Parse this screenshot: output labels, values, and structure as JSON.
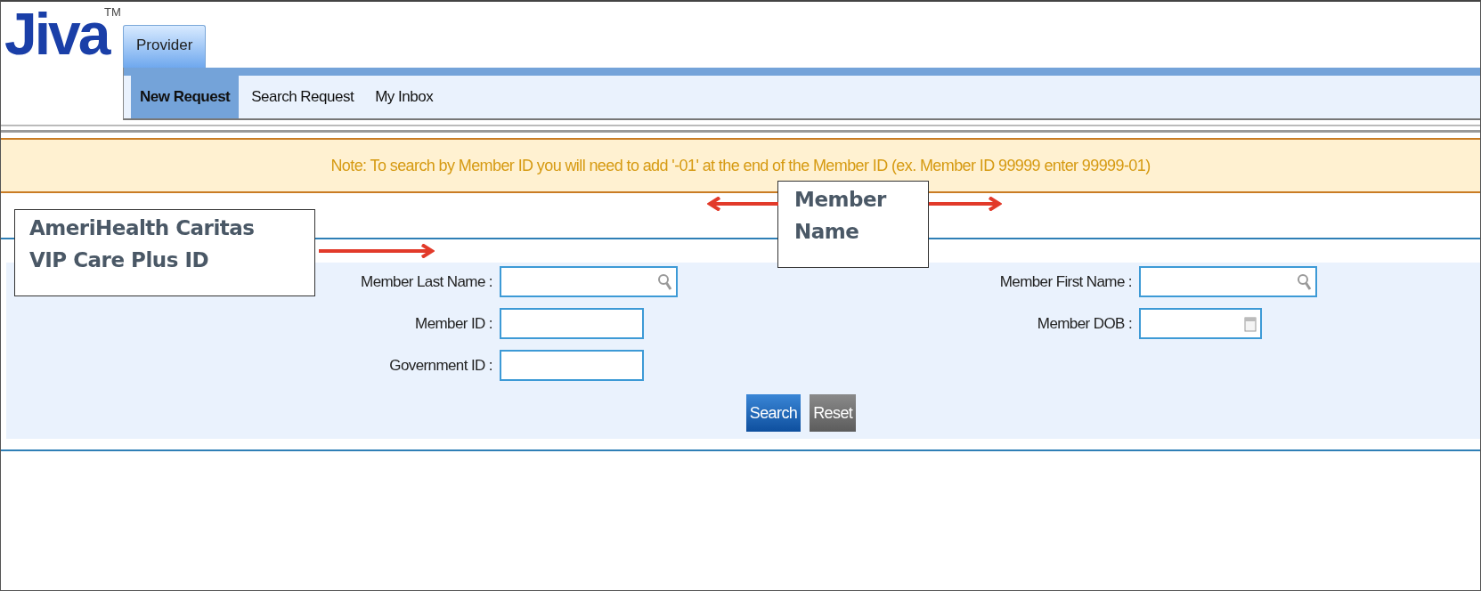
{
  "logo": {
    "text": "Jiva",
    "trademark": "TM"
  },
  "tabs": [
    {
      "label": "Provider",
      "selected": true
    }
  ],
  "subnav": [
    {
      "label": "New Request",
      "selected": true
    },
    {
      "label": "Search Request",
      "selected": false
    },
    {
      "label": "My Inbox",
      "selected": false
    }
  ],
  "note": "Note: To search by Member ID you will need to add '-01' at the end of the Member ID (ex. Member ID 99999 enter 99999-01)",
  "form": {
    "rows": [
      {
        "left": {
          "label": "Member Last Name :",
          "kind": "search"
        },
        "right": {
          "label": "Member First Name :",
          "kind": "search"
        }
      },
      {
        "left": {
          "label": "Member ID :",
          "kind": "text"
        },
        "right": {
          "label": "Member DOB :",
          "kind": "date"
        }
      },
      {
        "left": {
          "label": "Government ID :",
          "kind": "text"
        }
      }
    ],
    "buttons": [
      {
        "label": "Search",
        "kind": "primary"
      },
      {
        "label": "Reset",
        "kind": "secondary"
      }
    ]
  },
  "callouts": [
    {
      "text": "AmeriHealth Caritas VIP Care Plus ID",
      "arrow_left": false,
      "arrow_right": true
    },
    {
      "text": "Member Name",
      "arrow_left": true,
      "arrow_right": true
    }
  ]
}
